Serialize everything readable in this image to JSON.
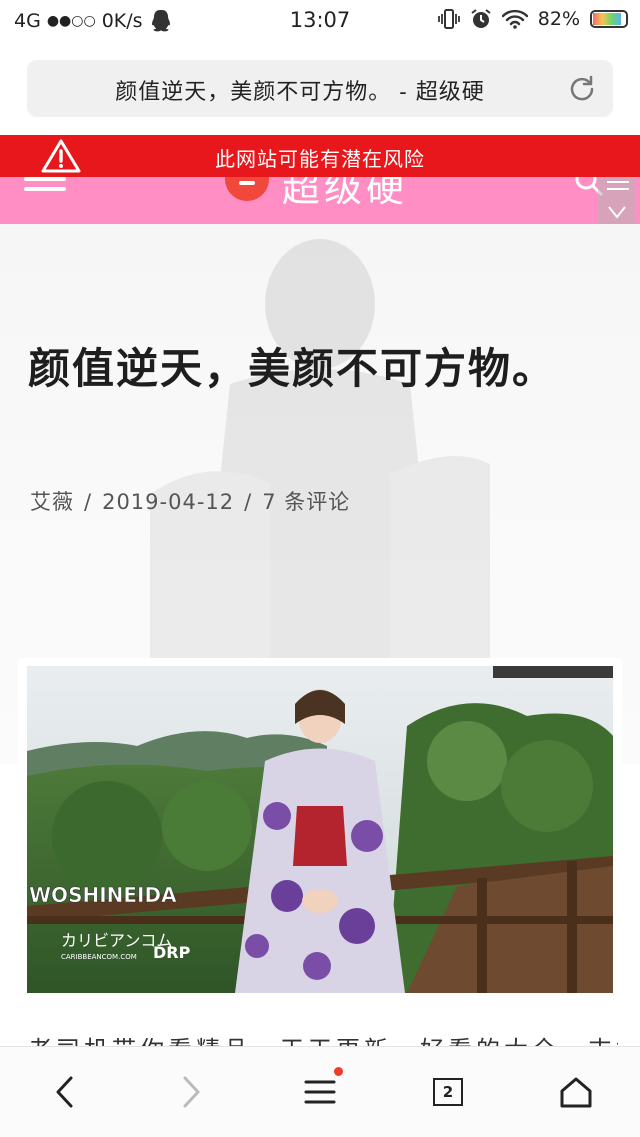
{
  "status_bar": {
    "network": "4G",
    "signal": "●●○○",
    "speed": "0K/s",
    "time": "13:07",
    "battery": "82%",
    "battery_level": 0.82,
    "icons": [
      "qq-icon",
      "vibrate-icon",
      "alarm-icon",
      "wifi-icon",
      "battery-icon"
    ]
  },
  "url_bar": {
    "title": "颜值逆天，美颜不可方物。 - 超级硬",
    "reload_icon": "reload-icon"
  },
  "warning": {
    "text": "此网站可能有潜在风险",
    "color": "#e8171b"
  },
  "site_header": {
    "name": "超级硬",
    "color": "#ff8ec4"
  },
  "article": {
    "title": "颜值逆天，美颜不可方物。",
    "author": "艾薇",
    "date": "2019-04-12",
    "comments": "7 条评论",
    "separator": "/",
    "body_start": "老司机带你看精品，天天更新，好看的大全，支持"
  },
  "photo": {
    "watermark": "WOSHINEIDA",
    "overlay_logo": "カリビアンコム",
    "overlay_sub": "CARIBBEANCOM.COM",
    "overlay_badge": "DRP"
  },
  "bottom_nav": {
    "tabs_count": "2",
    "icons": [
      "back-icon",
      "forward-icon",
      "menu-icon",
      "tabs-icon",
      "home-icon"
    ]
  }
}
